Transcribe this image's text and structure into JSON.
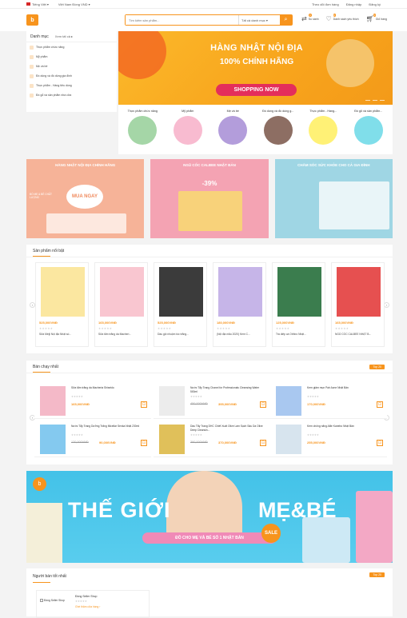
{
  "topbar": {
    "language": "Tiếng Việt",
    "currency": "Việt Nam Đồng VND",
    "links": [
      "Theo dõi đơn hàng",
      "Đăng nhập",
      "Đăng ký"
    ]
  },
  "header": {
    "logo_glyph": "b",
    "search_placeholder": "Tìm kiếm sản phẩm...",
    "search_category": "Tất cả danh mục",
    "compare_label": "So sánh",
    "compare_count": "0",
    "wishlist_label": "Danh sách yêu thích",
    "wishlist_count": "0",
    "cart_label": "Giỏ hàng",
    "cart_count": "0"
  },
  "sidebar": {
    "title": "Danh mục",
    "view_all": "Xem tất cả",
    "items": [
      {
        "label": "Thực phẩm chức năng"
      },
      {
        "label": "Mỹ phẩm"
      },
      {
        "label": "Mẹ và bé"
      },
      {
        "label": "Đồ dùng và đồ dùng gia đình"
      },
      {
        "label": "Thực phẩm - Hàng tiêu dùng"
      },
      {
        "label": "Đồ gỗ và sản phẩm nhà cửa"
      }
    ]
  },
  "hero": {
    "line1": "HÀNG NHẬT NỘI ĐỊA",
    "line2": "100% CHÍNH HÃNG",
    "cta": "SHOPPING NOW"
  },
  "categories": [
    {
      "label": "Thực phẩm chức năng",
      "color": "#a5d6a7"
    },
    {
      "label": "Mỹ phẩm",
      "color": "#f8bbd0"
    },
    {
      "label": "Mẹ và bé",
      "color": "#b39ddb"
    },
    {
      "label": "Đồ dùng và đồ dùng g...",
      "color": "#8d6e63"
    },
    {
      "label": "Thực phẩm - Hàng...",
      "color": "#fff176"
    },
    {
      "label": "Đồ gỗ và sản phẩm...",
      "color": "#80deea"
    }
  ],
  "promos": [
    {
      "title": "HÀNG NHẬT NỘI ĐỊA CHÍNH HÃNG",
      "big": "MUA NGAY",
      "small": "BỔ MẸ & BÉ CHẤT LƯỢNG",
      "bg": "#f6b398"
    },
    {
      "title": "NGŨ CỐC CALBEE NHẬT BẢN",
      "big": "-39%",
      "small": "",
      "bg": "#f4a3b3"
    },
    {
      "title": "CHĂM SÓC SỨC KHỎE CHO CẢ GIA ĐÌNH",
      "big": "",
      "small": "",
      "bg": "#9fd6e4"
    }
  ],
  "featured": {
    "title": "Sản phẩm nổi bật",
    "products": [
      {
        "name": "Sữa Meiji Nội địa Nhật số...",
        "price": "525,000VNĐ",
        "color": "#fbe7a0"
      },
      {
        "name": "Sữa tắm trắng da Macheri...",
        "price": "165,000VNĐ",
        "color": "#f9c6d0"
      },
      {
        "name": "Dầu gội nhuộm tóc trắng...",
        "price": "525,000VNĐ",
        "color": "#3b3b3b"
      },
      {
        "name": "(Nội địa mẫu 2020) Kem C...",
        "price": "180,000VNĐ",
        "color": "#c6b5e8"
      },
      {
        "name": "Trà diếp cá Orihiro Nhật...",
        "price": "125,000VNĐ",
        "color": "#3b7d4e"
      },
      {
        "name": "NGŨ CỐC CALBEE NHẬT B...",
        "price": "165,000VNĐ",
        "color": "#e65050"
      }
    ]
  },
  "bestsellers": {
    "title": "Bán chạy nhất",
    "top_label": "Top 20",
    "products": [
      {
        "name": "Sữa tắm trắng da Macheria Shiseido",
        "old": "",
        "price": "165,000VNĐ",
        "color": "#f4b9c8"
      },
      {
        "name": "Nước Tẩy Trang Chanel for Professionals Cleansing Water 500ml",
        "old": "450,000VNĐ",
        "price": "395,000VNĐ",
        "color": "#ececec"
      },
      {
        "name": "Kem giảm mụn Pair Acne Nhật Bản",
        "old": "",
        "price": "170,000VNĐ",
        "color": "#a9c8f0"
      },
      {
        "name": "Nước Tẩy Trang Dưỡng Trắng Micellar Senka Nhật 230ml",
        "old": "120,000VNĐ",
        "price": "90,000VNĐ",
        "color": "#84c9ef"
      },
      {
        "name": "Dầu Tẩy Trang DHC Chiết Xuất Olive Làm Sạch Sâu Da Olive Deep Cleansin...",
        "old": "390,000VNĐ",
        "price": "370,000VNĐ",
        "color": "#e0c05a"
      },
      {
        "name": "Kem chống nắng Allie Kanebo Nhật Bản",
        "old": "",
        "price": "255,000VNĐ",
        "color": "#d7e4ee"
      }
    ]
  },
  "banner": {
    "left_word": "THẾ GIỚI",
    "right_word": "MẸ&BÉ",
    "sale": "SALE",
    "subtitle": "ĐỒ CHO MẸ VÀ BÉ SỐ 1 NHẬT BẢN"
  },
  "sellers": {
    "title": "Người bán tốt nhất",
    "top_label": "Top 20",
    "card_left": "Đồng Seller Shop",
    "card_name": "Đồng Seller Shop",
    "card_link": "Ghé thăm cửa hàng"
  },
  "ui": {
    "stars": "★★★★★",
    "cart_glyph": "⊡",
    "arrow_left": "‹",
    "arrow_right": "›"
  }
}
